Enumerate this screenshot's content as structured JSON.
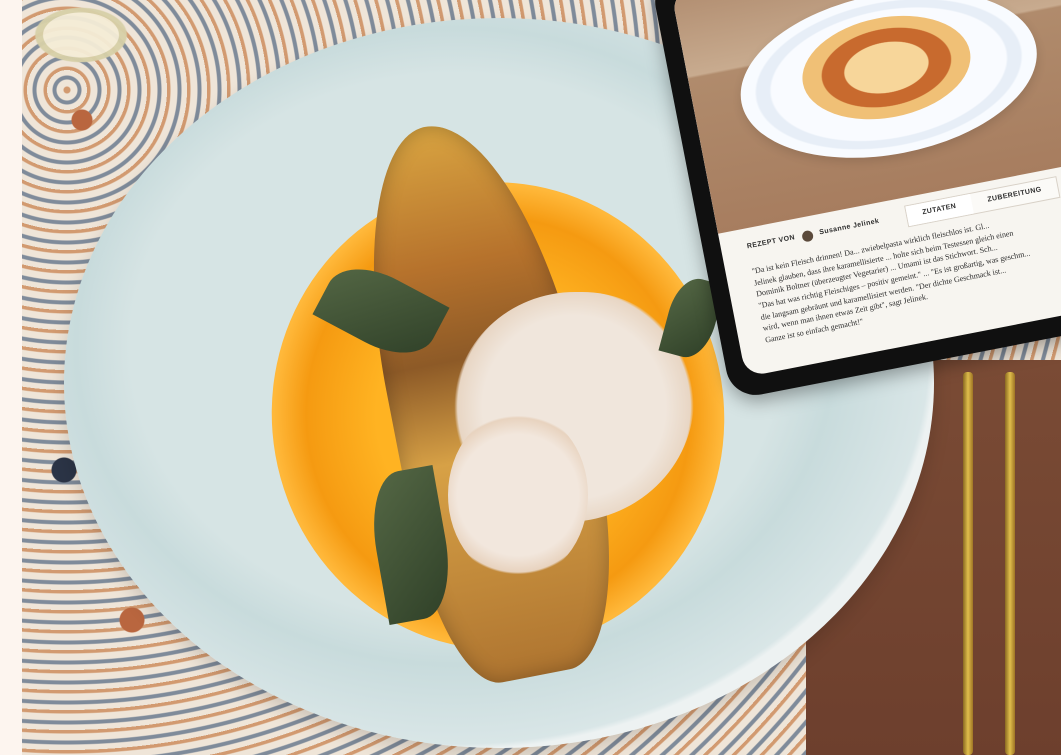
{
  "tablet": {
    "recipe_label": "REZEPT VON",
    "author": "Susanne Jelinek",
    "tab_ingredients": "ZUTATEN",
    "tab_preparation": "ZUBEREITUNG",
    "lines": [
      "\"Da ist kein Fleisch drinnen! Da... zwiebelpasta wirklich fleischlos ist. Gl...",
      "Jelinek glauben, dass ihre karamellisierte ... holte sich beim Testessen gleich einen",
      "Dominik Boltner (überzeugter Vegetarier) ... Umami ist das Stichwort. Sch...",
      "\"Das hat was richtig Fleischiges – positiv gemeint.\" ... \"Es ist großartig, was geschm...",
      "die langsam gebräunt und karamellisiert werden. \"Der dichte Geschmack ist...",
      "wird, wenn man ihnen etwas Zeit gibt\", sagt Jelinek.",
      "Ganze ist so einfach gemacht!\""
    ]
  }
}
